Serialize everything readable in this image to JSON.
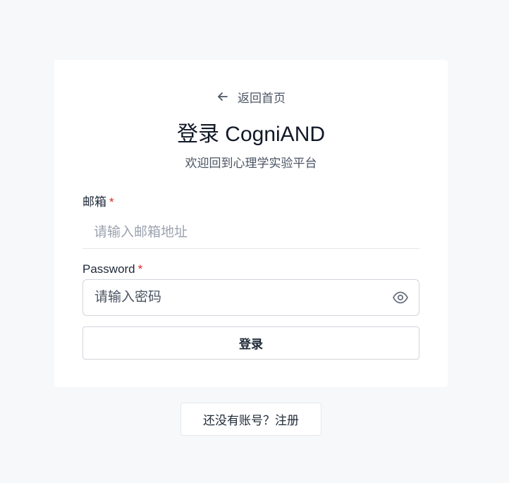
{
  "back_link": {
    "label": "返回首页",
    "icon": "arrow-left-icon"
  },
  "header": {
    "title": "登录 CogniAND",
    "subtitle": "欢迎回到心理学实验平台"
  },
  "form": {
    "email": {
      "label": "邮箱",
      "required_mark": "*",
      "value": "",
      "placeholder": "请输入邮箱地址"
    },
    "password": {
      "label": "Password",
      "required_mark": "*",
      "value": "",
      "placeholder": "请输入密码",
      "toggle_icon": "eye-icon"
    },
    "submit_label": "登录"
  },
  "register": {
    "label": "还没有账号？注册"
  },
  "colors": {
    "background": "#f7f8fa",
    "card": "#ffffff",
    "required": "#dc2626",
    "border": "#d1d5db",
    "muted_text": "#4b5563"
  }
}
